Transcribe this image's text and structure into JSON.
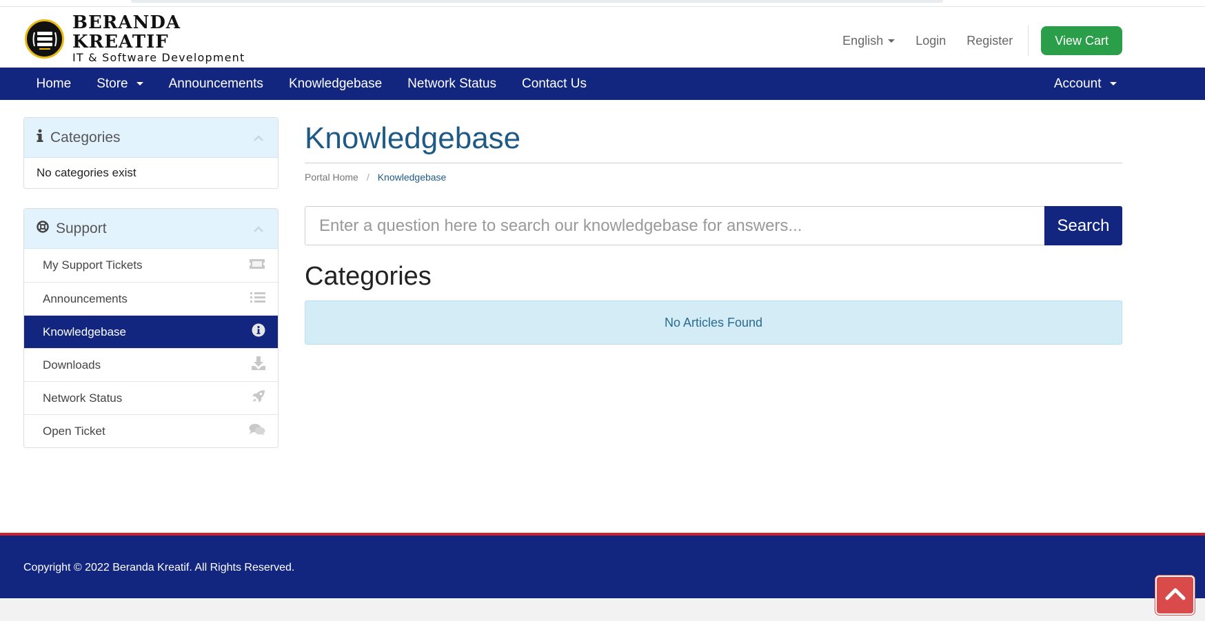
{
  "brand": {
    "name": "BERANDA KREATIF",
    "tagline": "IT & Software Development"
  },
  "header": {
    "language": "English",
    "login": "Login",
    "register": "Register",
    "view_cart": "View Cart"
  },
  "nav": {
    "items": [
      "Home",
      "Store",
      "Announcements",
      "Knowledgebase",
      "Network Status",
      "Contact Us"
    ],
    "account": "Account"
  },
  "sidebar": {
    "categories": {
      "title": "Categories",
      "empty_text": "No categories exist"
    },
    "support": {
      "title": "Support",
      "items": [
        {
          "label": "My Support Tickets",
          "icon": "ticket-icon"
        },
        {
          "label": "Announcements",
          "icon": "list-icon"
        },
        {
          "label": "Knowledgebase",
          "icon": "info-circle-icon",
          "active": true
        },
        {
          "label": "Downloads",
          "icon": "download-icon"
        },
        {
          "label": "Network Status",
          "icon": "rocket-icon"
        },
        {
          "label": "Open Ticket",
          "icon": "comments-icon"
        }
      ]
    }
  },
  "main": {
    "title": "Knowledgebase",
    "breadcrumb": [
      "Portal Home",
      "Knowledgebase"
    ],
    "search": {
      "placeholder": "Enter a question here to search our knowledgebase for answers...",
      "button": "Search"
    },
    "section_title": "Categories",
    "empty_message": "No Articles Found"
  },
  "footer": {
    "copyright": "Copyright © 2022 Beranda Kreatif. All Rights Reserved."
  },
  "colors": {
    "primary_navy": "#13267f",
    "accent_green": "#2b9e4a",
    "footer_red_line": "#d0222b",
    "title_blue": "#1e5a86",
    "panel_head_bg": "#e3f3fd",
    "alert_bg": "#d3ecf6"
  }
}
